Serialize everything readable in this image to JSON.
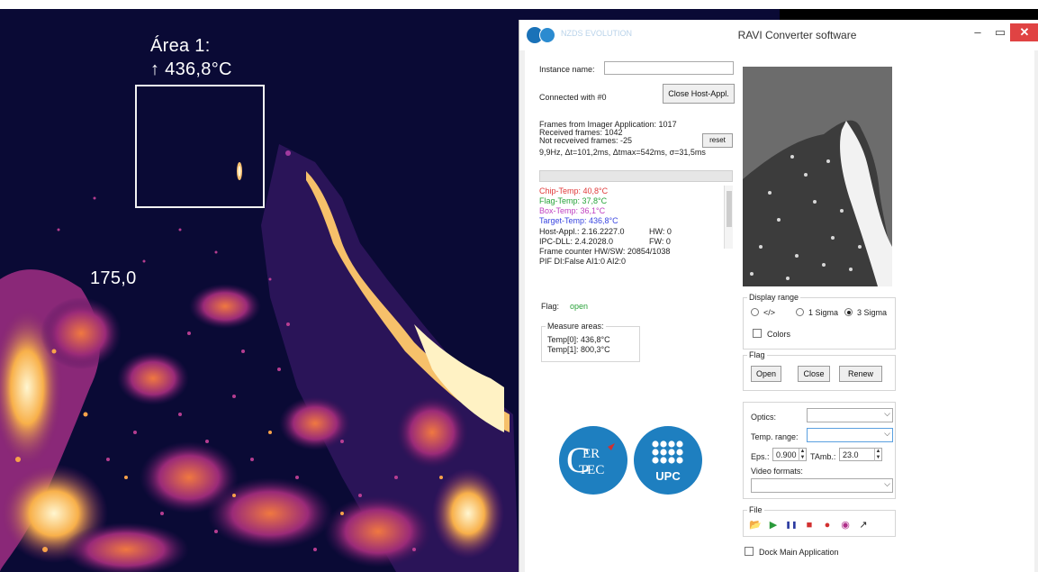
{
  "thermal_view": {
    "area_label": "Área 1:",
    "area_value": "↑ 436,8°C",
    "point_value": "175,0"
  },
  "window": {
    "title": "RAVI Converter software",
    "logo_text": "NZDS EVOLUTION",
    "controls": {
      "minimize": "–",
      "maximize": "▭",
      "close": "✕"
    }
  },
  "connection": {
    "instance_label": "Instance name:",
    "instance_value": "",
    "connected_text": "Connected with #0",
    "close_host_button": "Close Host-Appl."
  },
  "stats": {
    "frames_from_imager": "Frames from Imager Application: 1017",
    "received_frames": "Received frames: 1042",
    "not_received": "Not recveived frames: -25",
    "timing": "9,9Hz, Δt=101,2ms, Δtmax=542ms, σ=31,5ms",
    "reset_button": "reset",
    "progress_fraction": 0.0
  },
  "status": {
    "chip_temp": "Chip-Temp: 40,8°C",
    "flag_temp": "Flag-Temp: 37,8°C",
    "box_temp": "Box-Temp: 36,1°C",
    "target_temp": "Target-Temp: 436,8°C",
    "host_appl": "Host-Appl.: 2.16.2227.0",
    "hw": "HW: 0",
    "ipc_dll": "IPC-DLL: 2.4.2028.0",
    "fw": "FW: 0",
    "frame_counter": "Frame counter HW/SW: 20854/1038",
    "pif": "PIF   DI:False    AI1:0    AI2:0",
    "colors": {
      "chip": "#e03a3a",
      "flag": "#27a33a",
      "box": "#c040c0",
      "target": "#3a46e0"
    }
  },
  "flag_status": {
    "label": "Flag:",
    "value": "open",
    "value_color": "#2aa23a"
  },
  "measure_areas": {
    "title": "Measure areas:",
    "items": [
      "Temp[0]: 436,8°C",
      "Temp[1]: 800,3°C"
    ]
  },
  "display_range": {
    "title": "Display range",
    "options": [
      {
        "label": "</>",
        "selected": false
      },
      {
        "label": "1 Sigma",
        "selected": false
      },
      {
        "label": "3 Sigma",
        "selected": true
      }
    ],
    "colors_label": "Colors",
    "colors_checked": false
  },
  "flag_group": {
    "title": "Flag",
    "buttons": [
      "Open",
      "Close",
      "Renew"
    ]
  },
  "optics_group": {
    "optics_label": "Optics:",
    "optics_value": "",
    "temp_range_label": "Temp. range:",
    "temp_range_value": "",
    "eps_label": "Eps.:",
    "eps_value": "0.900",
    "tamb_label": "TAmb.:",
    "tamb_value": "23.0",
    "video_formats_label": "Video formats:",
    "video_formats_value": ""
  },
  "file_group": {
    "title": "File",
    "tools": [
      {
        "name": "open-folder-icon",
        "glyph": "📂",
        "color": "#e8b73a"
      },
      {
        "name": "play-icon",
        "glyph": "▶",
        "color": "#2a9a3a"
      },
      {
        "name": "pause-icon",
        "glyph": "❚❚",
        "color": "#2a3aa0"
      },
      {
        "name": "stop-icon",
        "glyph": "■",
        "color": "#d23030"
      },
      {
        "name": "record-icon",
        "glyph": "●",
        "color": "#d23030"
      },
      {
        "name": "camera-icon",
        "glyph": "◉",
        "color": "#b0308a"
      },
      {
        "name": "export-icon",
        "glyph": "↗",
        "color": "#222222"
      }
    ]
  },
  "dock": {
    "label": "Dock Main Application",
    "checked": false
  },
  "logos": {
    "cer_line1": "ER",
    "cer_line2": "TEC",
    "cer_letter": "C",
    "upc": "UPC",
    "brand_blue": "#1e7fc0"
  }
}
